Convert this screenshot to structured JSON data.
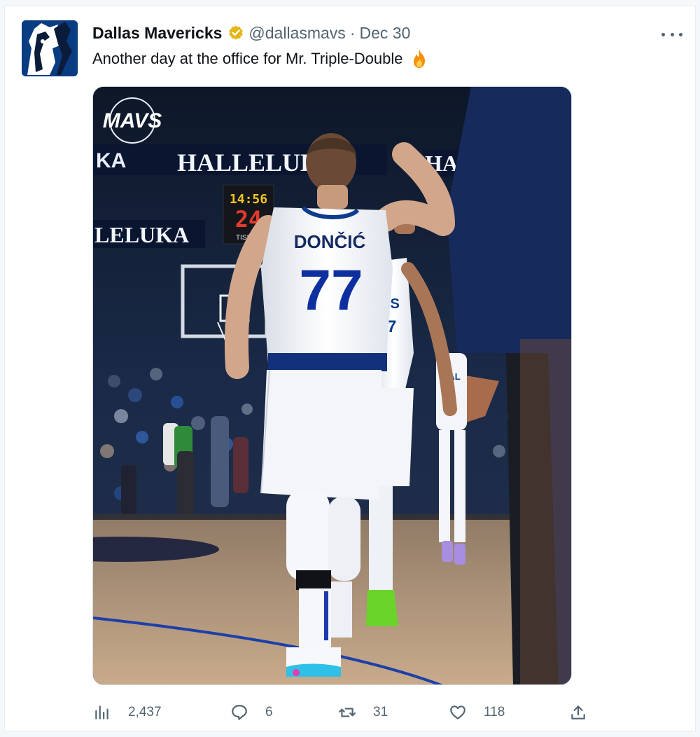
{
  "tweet": {
    "author_name": "Dallas Mavericks",
    "handle": "@dallasmavs",
    "separator": "·",
    "date": "Dec 30",
    "text": "Another day at the office for Mr. Triple-Double",
    "emoji": "fire-emoji",
    "verified": true
  },
  "media": {
    "logo_text": "MAVS",
    "banner_left": "KA",
    "banner_center": "HALLELUKA",
    "banner_right": "HA",
    "banner_lower": "LELUKA",
    "clock": "14:56",
    "shot_clock": "24",
    "sponsor": "TISSOT",
    "jersey_name": "DONČIĆ",
    "jersey_number": "77",
    "jersey2_text": "AS",
    "jersey2_number": "7",
    "jersey3_text": "DAL"
  },
  "actions": {
    "views": "2,437",
    "replies": "6",
    "retweets": "31",
    "likes": "118"
  },
  "icons": {
    "views": "bar-chart-icon",
    "reply": "speech-bubble-icon",
    "retweet": "retweet-arrows-icon",
    "like": "heart-icon",
    "share": "share-upload-icon",
    "more": "more-dots-icon",
    "verified": "verified-badge-icon"
  },
  "colors": {
    "verified": "#e2b719",
    "mavs_blue": "#0d3c8c",
    "muted_text": "#536471"
  }
}
